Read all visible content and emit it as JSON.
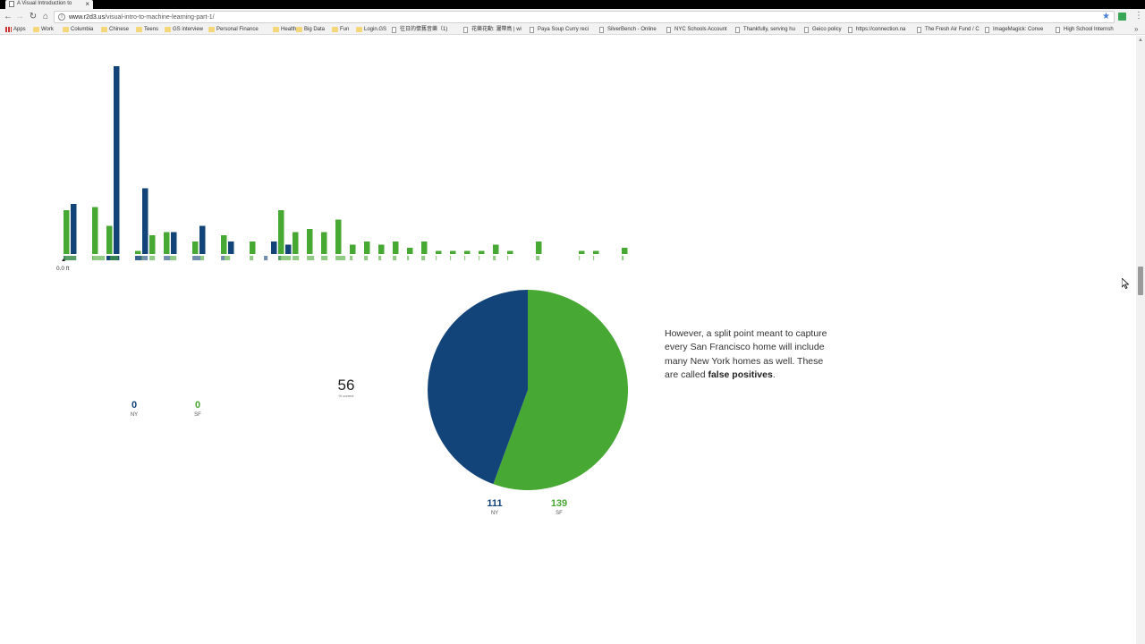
{
  "browser": {
    "tab_title": "A Visual Introduction to",
    "url_host": "www.r2d3.us",
    "url_path": "/visual-intro-to-machine-learning-part-1/",
    "bookmarks": [
      {
        "label": "Apps",
        "icon": "apps-icon"
      },
      {
        "label": "Work",
        "icon": "folder-icon"
      },
      {
        "label": "Columbia",
        "icon": "folder-icon"
      },
      {
        "label": "Chinese",
        "icon": "folder-icon"
      },
      {
        "label": "Teens",
        "icon": "folder-icon"
      },
      {
        "label": "GS interview",
        "icon": "folder-icon"
      },
      {
        "label": "Personal Finance",
        "icon": "folder-icon"
      },
      {
        "label": "Health",
        "icon": "folder-icon"
      },
      {
        "label": "Big Data",
        "icon": "folder-icon"
      },
      {
        "label": "Fun",
        "icon": "folder-icon"
      },
      {
        "label": "Login.GS",
        "icon": "folder-icon"
      },
      {
        "label": "往日的懷舊音樂（1)",
        "icon": "page-icon"
      },
      {
        "label": "花樂花動: 灑帶鳥 | wi",
        "icon": "page-icon"
      },
      {
        "label": "Paya Soup Curry reci",
        "icon": "page-icon"
      },
      {
        "label": "SilverBench - Online",
        "icon": "page-icon"
      },
      {
        "label": "NYC Schools Account",
        "icon": "page-icon"
      },
      {
        "label": "Thankfully, serving hu",
        "icon": "page-icon"
      },
      {
        "label": "Geico policy",
        "icon": "page-icon"
      },
      {
        "label": "https://connection.na",
        "icon": "page-icon"
      },
      {
        "label": "The Fresh Air Fund / C",
        "icon": "page-icon"
      },
      {
        "label": "ImageMagick: Conve",
        "icon": "page-icon"
      },
      {
        "label": "High School Internsh",
        "icon": "page-icon"
      }
    ]
  },
  "split": {
    "marker_label": "0.0 ft"
  },
  "left_counts": {
    "ny_value": "0",
    "ny_label": "NY",
    "sf_value": "0",
    "sf_label": "SF"
  },
  "accuracy": {
    "value": "56",
    "label": "% correct"
  },
  "right_counts": {
    "ny_value": "111",
    "ny_label": "NY",
    "sf_value": "139",
    "sf_label": "SF"
  },
  "narration": {
    "text_before": "However, a split point meant to capture every San Francisco home will include many New York homes as well. These are called ",
    "bold": "false positives",
    "text_after": "."
  },
  "colors": {
    "ny": "#134479",
    "sf": "#47a833"
  },
  "chart_data": [
    {
      "type": "bar",
      "xlabel": "",
      "ylabel": "",
      "series": [
        {
          "color": "ny",
          "values": [
            16,
            0,
            0,
            60,
            0,
            21,
            0,
            7,
            0,
            9,
            0,
            4,
            0,
            0,
            4,
            3,
            0,
            0,
            0,
            0,
            0,
            0,
            0,
            0,
            0,
            0,
            0,
            0,
            0,
            0,
            0,
            0,
            0,
            0,
            0,
            0,
            0,
            0,
            0,
            0
          ]
        },
        {
          "color": "sf",
          "values": [
            14,
            0,
            15,
            9,
            0,
            1,
            6,
            7,
            0,
            4,
            0,
            6,
            0,
            4,
            0,
            14,
            7,
            8,
            7,
            11,
            3,
            4,
            3,
            4,
            2,
            4,
            1,
            1,
            1,
            1,
            3,
            1,
            0,
            4,
            0,
            0,
            1,
            1,
            0,
            2
          ]
        }
      ]
    },
    {
      "type": "pie",
      "categories": [
        "NY",
        "SF"
      ],
      "values": [
        111,
        139
      ]
    }
  ]
}
